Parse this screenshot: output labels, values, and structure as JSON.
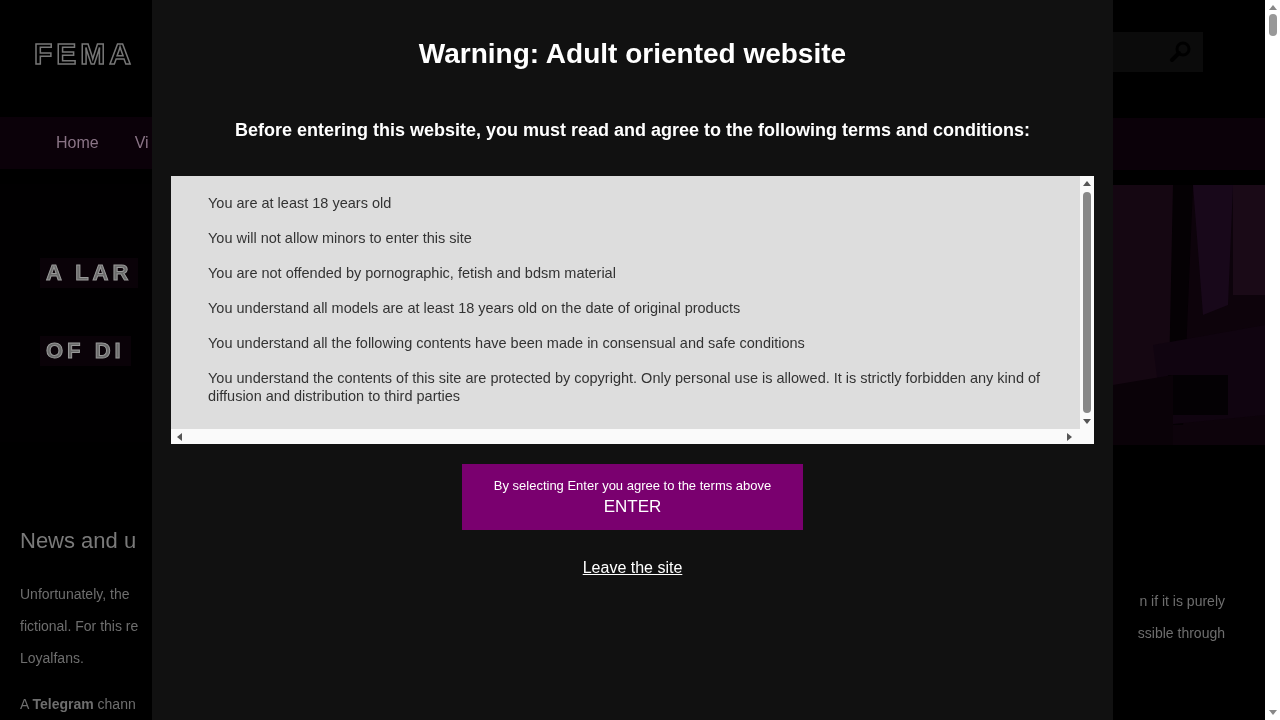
{
  "background": {
    "logo": "FEMA",
    "nav": [
      "Home",
      "Vi"
    ],
    "hero_lines": [
      "A LAR",
      "OF DI"
    ],
    "heading": "News and u",
    "left_lines": [
      "Unfortunately, the",
      "fictional. For this re",
      "Loyalfans."
    ],
    "telegram": "A **Telegram** chann",
    "right_lines": [
      "n if it is purely",
      "ssible through"
    ]
  },
  "modal": {
    "title": "Warning: Adult oriented website",
    "subtitle": "Before entering this website, you must read and agree to the following terms and conditions:",
    "terms": [
      "You are at least 18 years old",
      "You will not allow minors to enter this site",
      "You are not offended by pornographic, fetish and bdsm material",
      "You understand all models are at least 18 years old on the date of original products",
      "You understand all the following contents have been made in consensual and safe conditions",
      "You understand the contents of this site are protected by copyright. Only personal use is allowed. It is strictly forbidden any kind of diffusion and distribution to third parties"
    ],
    "enter_button": {
      "note": "By selecting Enter you agree to the terms above",
      "label": "ENTER"
    },
    "leave_link": "Leave the site"
  }
}
